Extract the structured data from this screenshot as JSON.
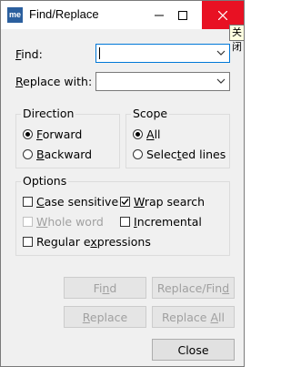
{
  "window": {
    "title": "Find/Replace",
    "app_icon_text": "me",
    "tooltip": "关闭"
  },
  "fields": {
    "find_label_u": "F",
    "find_label_rest": "ind:",
    "find_value": "",
    "replace_label_u": "R",
    "replace_label_rest": "eplace with:",
    "replace_value": ""
  },
  "direction": {
    "title": "Direction",
    "forward_u": "F",
    "forward_rest": "orward",
    "backward_u": "B",
    "backward_rest": "ackward",
    "selected": "forward"
  },
  "scope": {
    "title": "Scope",
    "all_u": "A",
    "all_rest": "ll",
    "selected_lines_a": "Selec",
    "selected_lines_u": "t",
    "selected_lines_b": "ed lines",
    "selected": "all"
  },
  "options": {
    "title": "Options",
    "case_sensitive_u": "C",
    "case_sensitive_rest": "ase sensitive",
    "case_sensitive_checked": false,
    "wrap_search_u": "W",
    "wrap_search_rest": "rap search",
    "wrap_search_checked": true,
    "whole_word_u": "W",
    "whole_word_rest": "hole word",
    "whole_word_enabled": false,
    "incremental_u": "I",
    "incremental_rest": "ncremental",
    "incremental_checked": false,
    "regex_a": "Regular e",
    "regex_u": "x",
    "regex_b": "pressions",
    "regex_checked": false
  },
  "buttons": {
    "find_a": "Fi",
    "find_u": "n",
    "find_b": "d",
    "replace_find_a": "Replace/Fin",
    "replace_find_u": "d",
    "replace_a": "",
    "replace_u": "R",
    "replace_b": "eplace",
    "replace_all_a": "Replace ",
    "replace_all_u": "A",
    "replace_all_b": "ll",
    "close": "Close"
  },
  "colors": {
    "close_hover": "#e81123",
    "focus_border": "#0078d7",
    "disabled_text": "#a0a0a0"
  }
}
